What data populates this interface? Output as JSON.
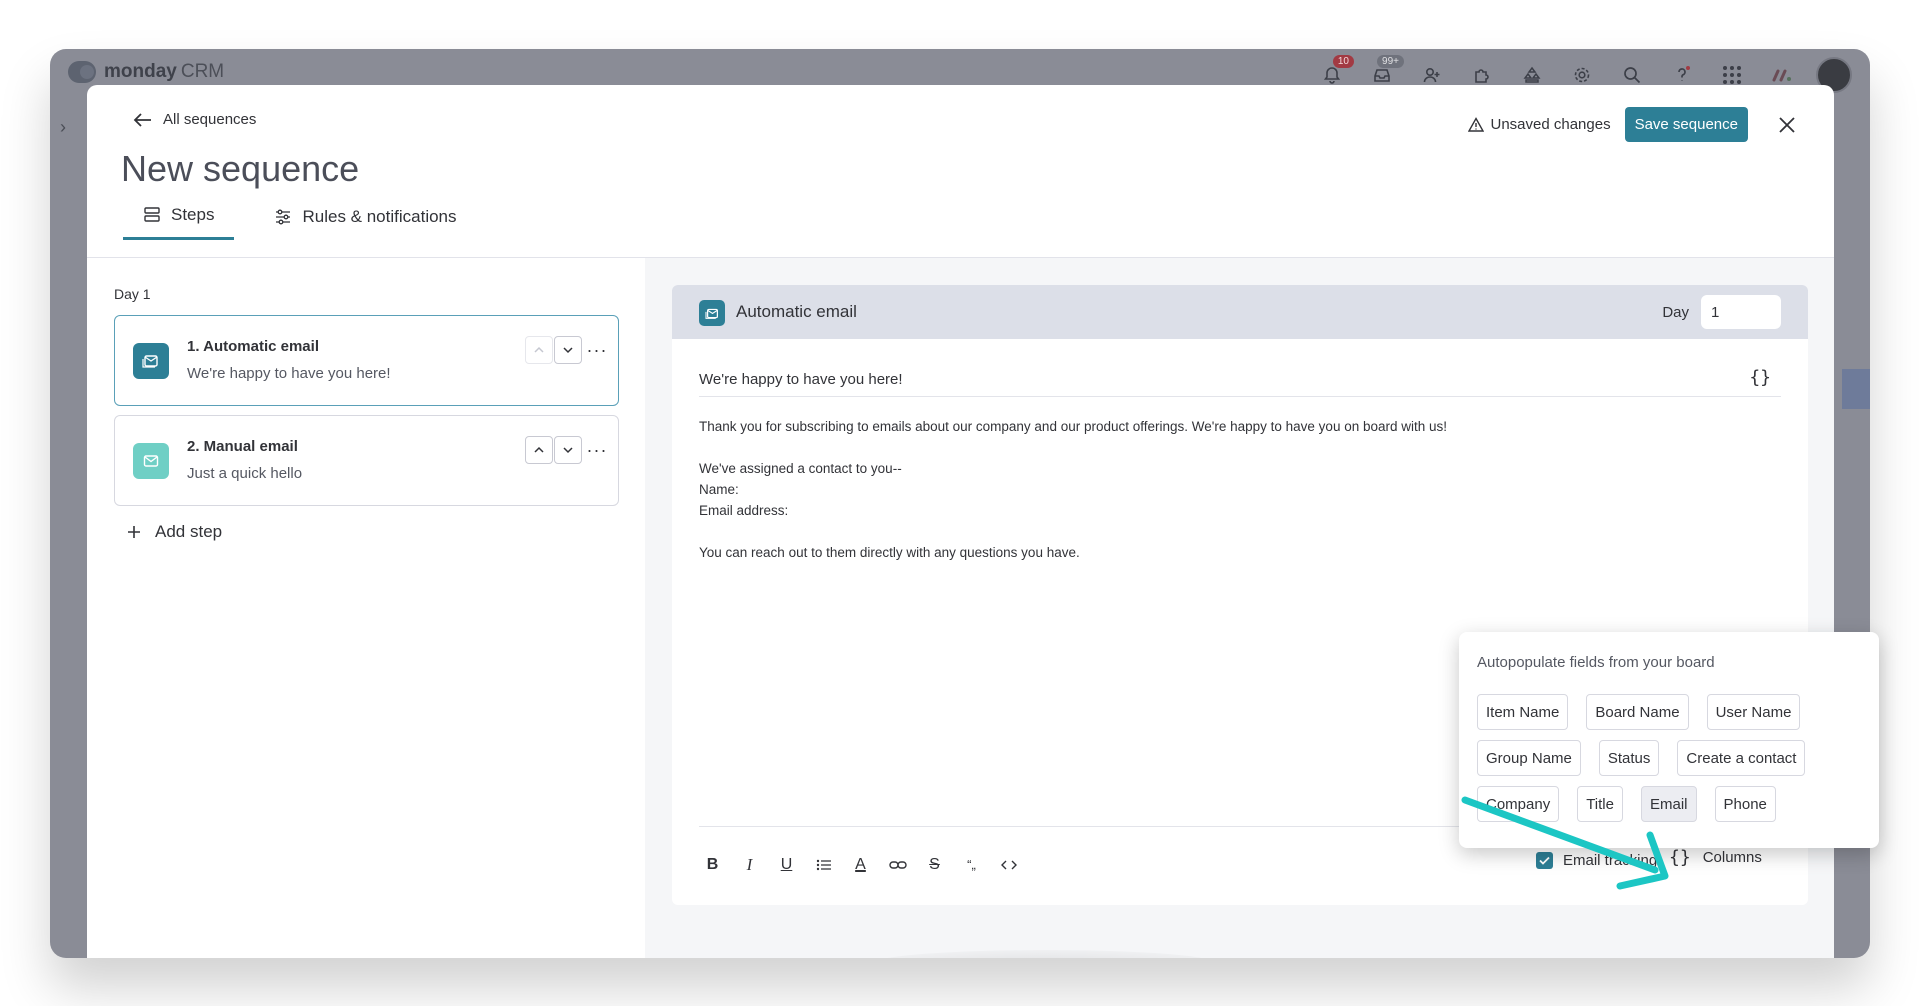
{
  "app": {
    "brand_name": "monday",
    "brand_sub": "CRM",
    "notifications_badge": "10",
    "inbox_badge": "99+"
  },
  "modal": {
    "back_label": "All sequences",
    "title": "New sequence",
    "unsaved_label": "Unsaved changes",
    "save_label": "Save sequence",
    "tabs": [
      {
        "label": "Steps"
      },
      {
        "label": "Rules & notifications"
      }
    ]
  },
  "steps": {
    "day_label": "Day 1",
    "items": [
      {
        "title": "1. Automatic email",
        "subtitle": "We're happy to have you here!"
      },
      {
        "title": "2. Manual email",
        "subtitle": "Just a quick hello"
      }
    ],
    "add_label": "Add step"
  },
  "editor": {
    "header_title": "Automatic email",
    "day_label": "Day",
    "day_value": "1",
    "subject": "We're happy to have you here!",
    "body": [
      "Thank you for subscribing to emails about our company and our product offerings. We're happy to have you on board with us!",
      "",
      "We've assigned a contact to you--",
      "Name:",
      "Email address:",
      "",
      "You can reach out to them directly with any questions you have."
    ],
    "email_tracking_label": "Email tracking",
    "columns_label": "Columns"
  },
  "popover": {
    "title": "Autopopulate fields from your board",
    "rows": [
      [
        "Item Name",
        "Board Name",
        "User Name"
      ],
      [
        "Group Name",
        "Status",
        "Create a contact"
      ],
      [
        "Company",
        "Title",
        "Email",
        "Phone"
      ]
    ]
  },
  "colors": {
    "accent": "#2d7f96",
    "annotation_arrow": "#1cc6c4"
  }
}
